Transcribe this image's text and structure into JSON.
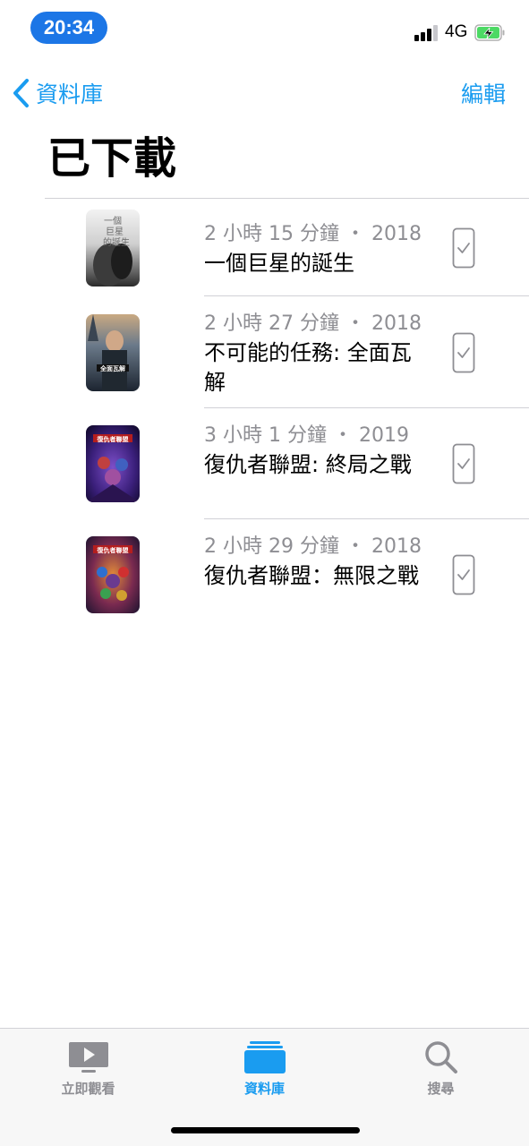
{
  "status_bar": {
    "time": "20:34",
    "network": "4G",
    "signal_icon": "cellular-signal-icon",
    "battery_icon": "battery-charging-icon",
    "battery_color": "#4cd964"
  },
  "nav": {
    "back_label": "資料庫",
    "edit_label": "編輯",
    "accent": "#1a9cf0"
  },
  "page_title": "已下載",
  "downloads": [
    {
      "meta": "2 小時 15 分鐘 ・ 2018",
      "title": "一個巨星的誕生",
      "poster_text": "一個巨星的誕生"
    },
    {
      "meta": "2 小時 27 分鐘 ・ 2018",
      "title": "不可能的任務: 全面瓦解",
      "poster_text": "全面瓦解"
    },
    {
      "meta": "3 小時 1 分鐘 ・ 2019",
      "title": "復仇者聯盟: 終局之戰",
      "poster_text": "復仇者聯盟"
    },
    {
      "meta": "2 小時 29 分鐘 ・ 2018",
      "title": "復仇者聯盟：無限之戰",
      "poster_text": "復仇者聯盟"
    }
  ],
  "tabs": [
    {
      "label": "立即觀看",
      "icon": "play-screen-icon",
      "active": false
    },
    {
      "label": "資料庫",
      "icon": "library-stack-icon",
      "active": true
    },
    {
      "label": "搜尋",
      "icon": "search-icon",
      "active": false
    }
  ]
}
